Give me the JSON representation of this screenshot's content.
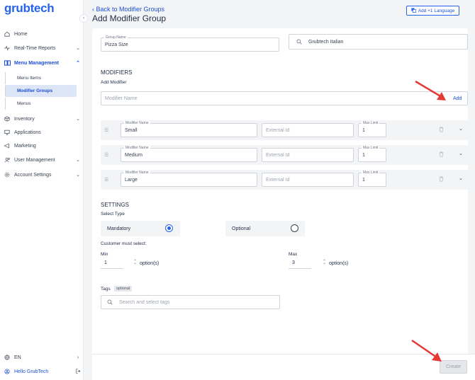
{
  "app": {
    "logo": "grubtech"
  },
  "sidebar": {
    "items": [
      {
        "label": "Home",
        "icon": "home-icon"
      },
      {
        "label": "Real-Time Reports",
        "icon": "pulse-icon"
      },
      {
        "label": "Menu Management",
        "icon": "book-icon"
      },
      {
        "label": "Inventory",
        "icon": "box-icon"
      },
      {
        "label": "Applications",
        "icon": "monitor-icon"
      },
      {
        "label": "Marketing",
        "icon": "megaphone-icon"
      },
      {
        "label": "User Management",
        "icon": "users-icon"
      },
      {
        "label": "Account Settings",
        "icon": "gear-icon"
      }
    ],
    "sub_items": [
      "Menu Items",
      "Modifier Groups",
      "Menus"
    ],
    "language": "EN",
    "user": "Hello GrubTech"
  },
  "header": {
    "back_label": "Back to Modifier Groups",
    "title": "Add Modifier Group",
    "language_button": "Add +1 Language"
  },
  "form": {
    "group_name_label": "Group Name",
    "group_name_value": "Pizza Size",
    "brand_value": "Grubtech Italian",
    "modifiers_title": "MODIFIERS",
    "add_modifier_label": "Add Modifier",
    "modifier_name_placeholder": "Modifier Name",
    "add_button": "Add",
    "modifier_name_label": "Modifier Name",
    "external_id_placeholder": "External Id",
    "max_limit_label": "Max Limit",
    "modifiers": [
      {
        "name": "Small",
        "max_limit": "1"
      },
      {
        "name": "Medium",
        "max_limit": "1"
      },
      {
        "name": "Large",
        "max_limit": "1"
      }
    ],
    "settings_title": "SETTINGS",
    "select_type_label": "Select Type",
    "mandatory_label": "Mandatory",
    "optional_label": "Optional",
    "selected_type": "Mandatory",
    "customer_must_select": "Customer must select:",
    "min_label": "Min",
    "min_value": "1",
    "max_label": "Max",
    "max_value": "3",
    "options_suffix": "option(s)",
    "tags_label": "Tags",
    "tags_badge": "optional",
    "tags_placeholder": "Search and select tags"
  },
  "footer": {
    "create_button": "Create"
  },
  "colors": {
    "accent": "#2563eb",
    "annotation_arrow": "#e53935"
  }
}
